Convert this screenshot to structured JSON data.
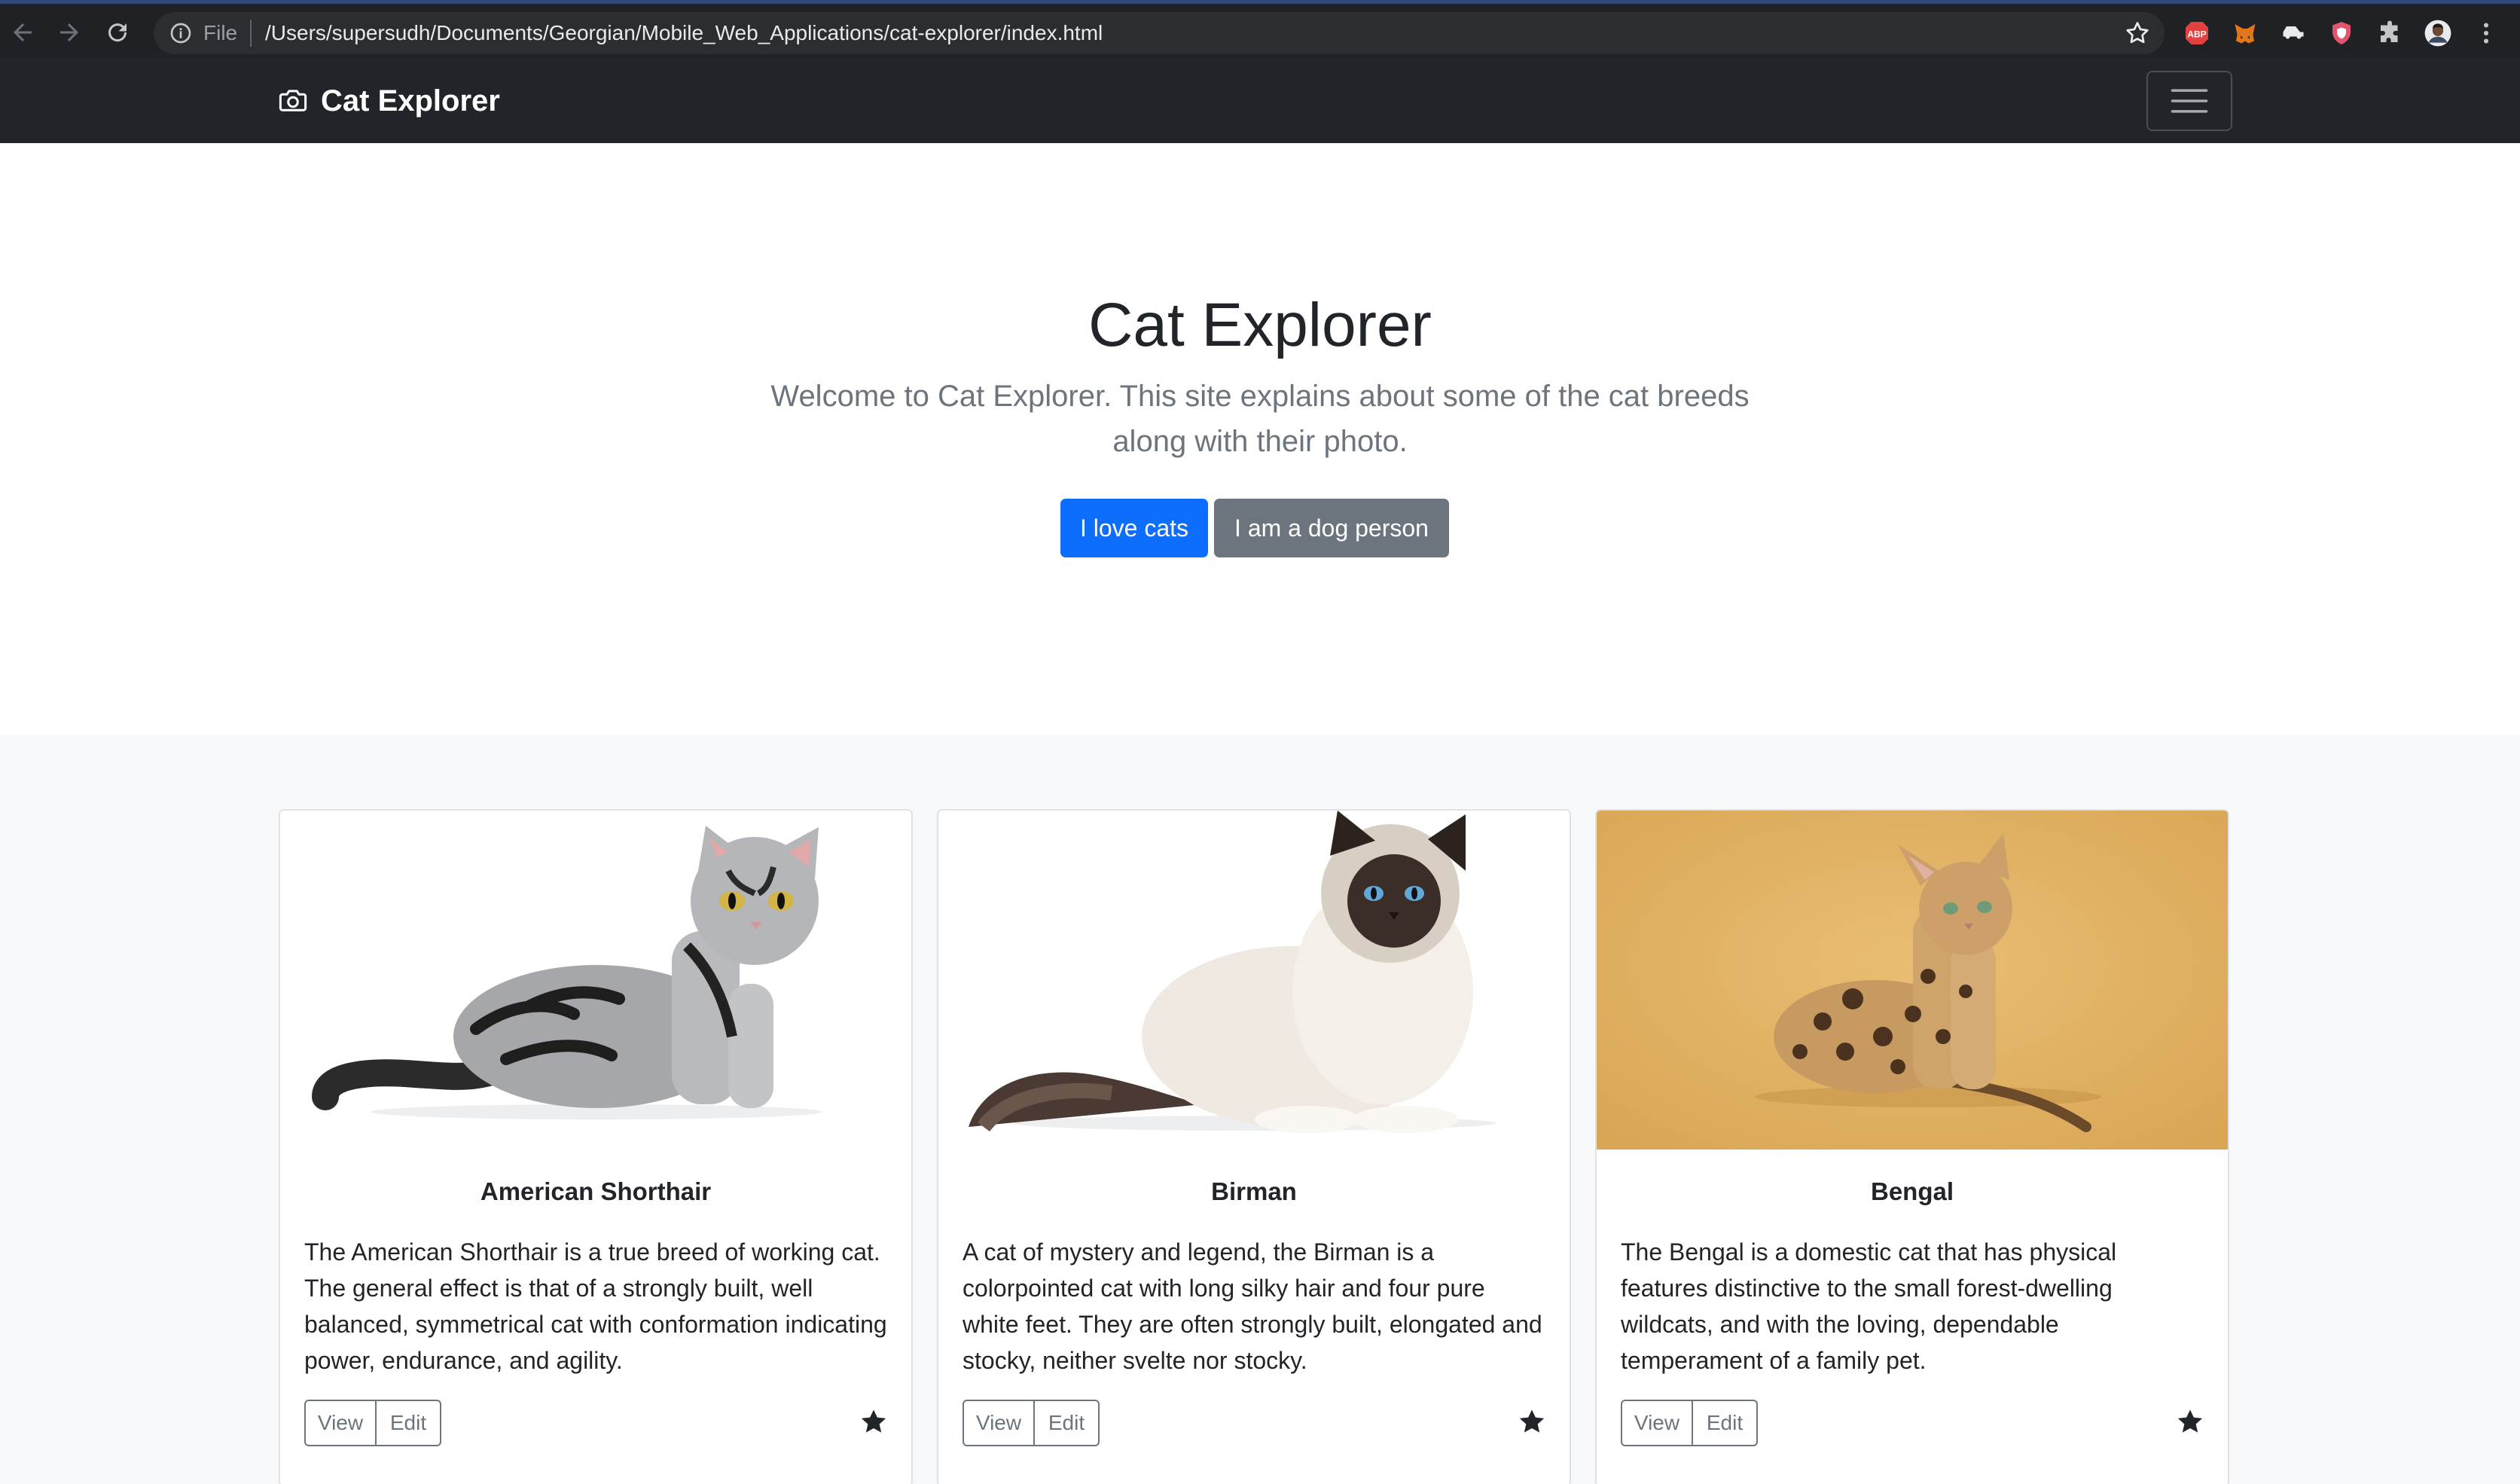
{
  "browser": {
    "scheme_label": "File",
    "url": "/Users/supersudh/Documents/Georgian/Mobile_Web_Applications/cat-explorer/index.html",
    "extensions": [
      "abp-icon",
      "metamask-icon",
      "car-icon",
      "shield-icon",
      "puzzle-icon",
      "profile-avatar",
      "more-icon"
    ],
    "extension_abp_label": "ABP"
  },
  "navbar": {
    "brand": "Cat Explorer"
  },
  "hero": {
    "title": "Cat Explorer",
    "lead": "Welcome to Cat Explorer. This site explains about some of the cat breeds along with their photo.",
    "primary_button": "I love cats",
    "secondary_button": "I am a dog person"
  },
  "cards": [
    {
      "title": "American Shorthair",
      "text": "The American Shorthair is a true breed of working cat. The general effect is that of a strongly built, well balanced, symmetrical cat with conformation indicating power, endurance, and agility.",
      "view_label": "View",
      "edit_label": "Edit"
    },
    {
      "title": "Birman",
      "text": "A cat of mystery and legend, the Birman is a colorpointed cat with long silky hair and four pure white feet. They are often strongly built, elongated and stocky, neither svelte nor stocky.",
      "view_label": "View",
      "edit_label": "Edit"
    },
    {
      "title": "Bengal",
      "text": "The Bengal is a domestic cat that has physical features distinctive to the small forest-dwelling wildcats, and with the loving, dependable temperament of a family pet.",
      "view_label": "View",
      "edit_label": "Edit"
    }
  ],
  "colors": {
    "primary": "#0d6efd",
    "secondary": "#6c757d",
    "navbar": "#212529",
    "album_bg": "#f8f9fa"
  }
}
